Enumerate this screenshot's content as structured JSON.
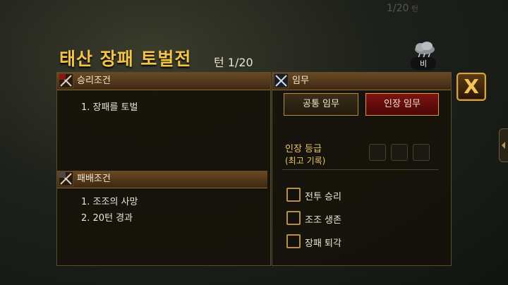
{
  "background": {
    "turn_text": "1/20",
    "turn_suffix": "턴"
  },
  "title": "태산 장패 토벌전",
  "turn": "턴 1/20",
  "weather": {
    "icon": "storm-cloud-icon",
    "label": "비"
  },
  "close_button": {
    "label": "X"
  },
  "victory": {
    "header": "승리조건",
    "emblem": "勝",
    "items": [
      "1. 장패를 토벌"
    ]
  },
  "defeat": {
    "header": "패배조건",
    "emblem": "敗",
    "items": [
      "1. 조조의 사망",
      "2. 20턴 경과"
    ]
  },
  "mission": {
    "header": "임무",
    "tabs": [
      {
        "label": "공통 임무",
        "active": false
      },
      {
        "label": "인장 임무",
        "active": true
      }
    ],
    "grade_label_1": "인장 등급",
    "grade_label_2": "(최고 기록)",
    "grade_slots": 3,
    "checks": [
      {
        "label": "전투 승리",
        "checked": false
      },
      {
        "label": "조조 생존",
        "checked": false
      },
      {
        "label": "장패 퇴각",
        "checked": false
      }
    ]
  },
  "colors": {
    "title": "#f4c34a",
    "active_tab": "#7e1212",
    "grade_text": "#e8c66a",
    "frame": "#b58b44"
  }
}
